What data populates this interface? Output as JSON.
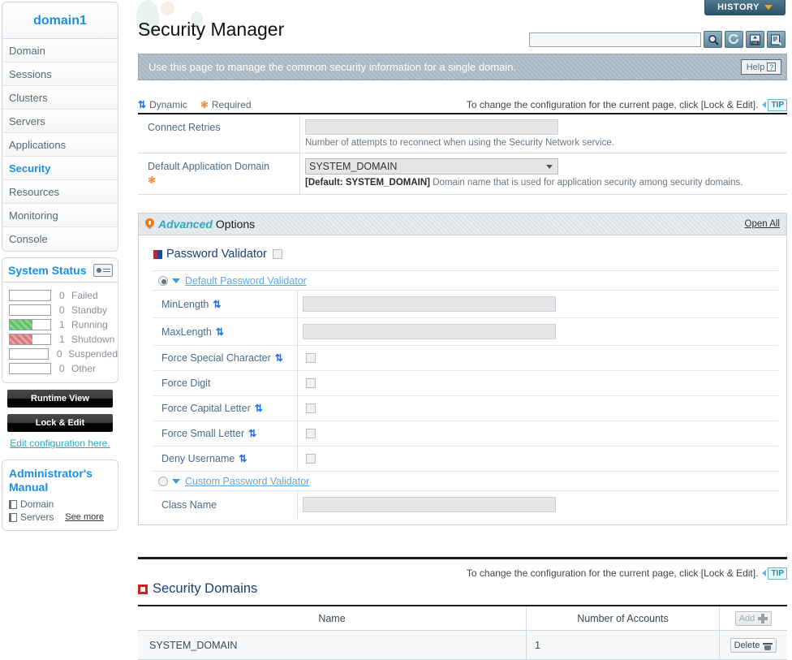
{
  "sidebar": {
    "domain_title": "domain1",
    "nav_items": [
      {
        "label": "Domain",
        "active": false
      },
      {
        "label": "Sessions",
        "active": false
      },
      {
        "label": "Clusters",
        "active": false
      },
      {
        "label": "Servers",
        "active": false
      },
      {
        "label": "Applications",
        "active": false
      },
      {
        "label": "Security",
        "active": true
      },
      {
        "label": "Resources",
        "active": false
      },
      {
        "label": "Monitoring",
        "active": false
      },
      {
        "label": "Console",
        "active": false
      }
    ],
    "system_status": {
      "title": "System Status",
      "rows": [
        {
          "count": "0",
          "label": "Failed",
          "fill": 0,
          "color": "none"
        },
        {
          "count": "0",
          "label": "Standby",
          "fill": 0,
          "color": "none"
        },
        {
          "count": "1",
          "label": "Running",
          "fill": 55,
          "color": "#63c06a"
        },
        {
          "count": "1",
          "label": "Shutdown",
          "fill": 55,
          "color": "#d97b7b"
        },
        {
          "count": "0",
          "label": "Suspended",
          "fill": 0,
          "color": "none"
        },
        {
          "count": "0",
          "label": "Other",
          "fill": 0,
          "color": "none"
        }
      ]
    },
    "runtime_view_label": "Runtime View",
    "lock_edit_label": "Lock & Edit",
    "edit_config_link": "Edit configuration here.",
    "manual": {
      "title": "Administrator's Manual",
      "items": [
        "Domain",
        "Servers"
      ],
      "see_more": "See more"
    }
  },
  "header": {
    "page_title": "Security Manager",
    "history_label": "HISTORY",
    "search_value": "",
    "search_placeholder": "",
    "toolbar_icons": [
      "search-icon",
      "refresh-icon",
      "export-xml-icon",
      "export-report-icon"
    ]
  },
  "info_bar": {
    "message": "Use this page to manage the common security information for a single domain.",
    "help_label": "Help"
  },
  "legend": {
    "dynamic": "Dynamic",
    "required": "Required",
    "lock_notice": "To change the configuration for the current page, click [Lock & Edit].",
    "tip_label": "TIP"
  },
  "form": {
    "rows": [
      {
        "label": "Connect Retries",
        "required": false,
        "type": "text",
        "value": "",
        "help_prefix": "",
        "help": "Number of attempts to reconnect when using the Security Network service."
      },
      {
        "label": "Default Application Domain",
        "required": true,
        "type": "select",
        "value": "SYSTEM_DOMAIN",
        "help_prefix": "[Default: SYSTEM_DOMAIN]",
        "help": "Domain name that is used for application security among security domains."
      }
    ]
  },
  "advanced": {
    "title_italic": "Advanced",
    "title_rest": "Options",
    "open_all": "Open All",
    "password_validator": {
      "title": "Password Validator",
      "checked": false,
      "default_validator": {
        "label": "Default Password Validator",
        "selected": true,
        "fields": [
          {
            "label": "MinLength",
            "dynamic": true,
            "type": "text",
            "value": ""
          },
          {
            "label": "MaxLength",
            "dynamic": true,
            "type": "text",
            "value": ""
          },
          {
            "label": "Force Special Character",
            "dynamic": true,
            "type": "checkbox",
            "checked": false
          },
          {
            "label": "Force Digit",
            "dynamic": false,
            "type": "checkbox",
            "checked": false
          },
          {
            "label": "Force Capital Letter",
            "dynamic": true,
            "type": "checkbox",
            "checked": false
          },
          {
            "label": "Force Small Letter",
            "dynamic": true,
            "type": "checkbox",
            "checked": false
          },
          {
            "label": "Deny Username",
            "dynamic": true,
            "type": "checkbox",
            "checked": false
          }
        ]
      },
      "custom_validator": {
        "label": "Custom Password Validator",
        "selected": false,
        "fields": [
          {
            "label": "Class Name",
            "dynamic": false,
            "type": "text",
            "value": ""
          }
        ]
      }
    }
  },
  "security_domains": {
    "title": "Security Domains",
    "columns": [
      "Name",
      "Number of Accounts"
    ],
    "add_label": "Add",
    "delete_label": "Delete",
    "rows": [
      {
        "name": "SYSTEM_DOMAIN",
        "accounts": "1"
      }
    ]
  }
}
